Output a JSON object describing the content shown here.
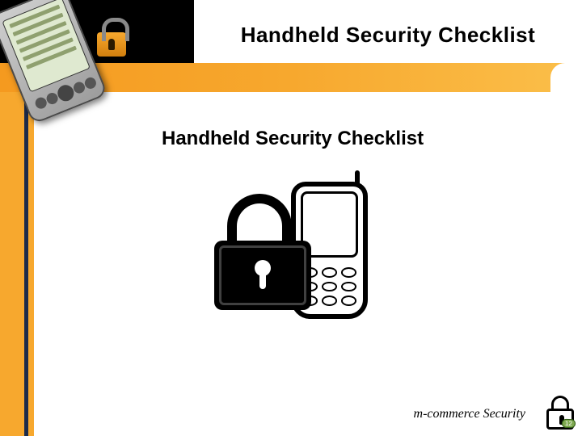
{
  "header": {
    "title": "Handheld Security Checklist"
  },
  "subtitle": "Handheld Security Checklist",
  "footer": {
    "caption": "m-commerce Security",
    "badge": "12"
  }
}
